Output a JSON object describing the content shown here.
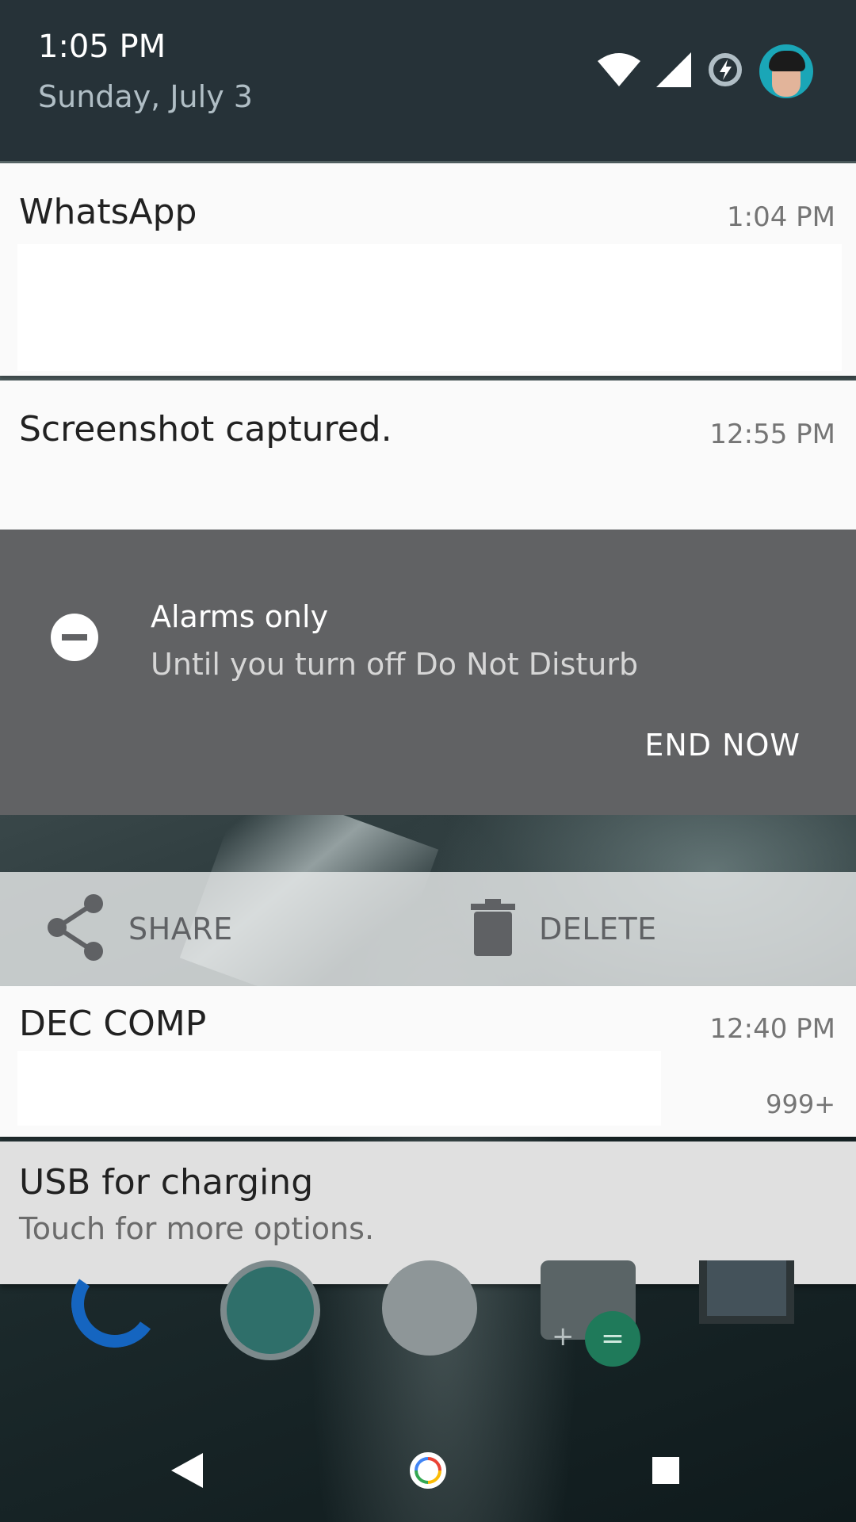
{
  "header": {
    "time": "1:05 PM",
    "date": "Sunday, July 3"
  },
  "status_icons": [
    "wifi-icon",
    "cell-signal-icon",
    "data-saver-icon",
    "avatar"
  ],
  "notifications": {
    "whatsapp": {
      "title": "WhatsApp",
      "time": "1:04 PM"
    },
    "screenshot": {
      "title": "Screenshot captured.",
      "time": "12:55 PM"
    },
    "dec_comp": {
      "title": "DEC COMP",
      "time": "12:40 PM",
      "count": "999+"
    },
    "usb": {
      "title": "USB for charging",
      "subtitle": "Touch for more options."
    }
  },
  "dnd": {
    "title": "Alarms only",
    "subtitle": "Until you turn off Do Not Disturb",
    "action": "END NOW"
  },
  "screenshot_actions": {
    "share": "SHARE",
    "delete": "DELETE"
  },
  "colors": {
    "header_bg": "#263238",
    "dnd_bg": "#616264",
    "card_bg": "#fafafa",
    "usb_bg": "#e0e0e0"
  },
  "navbar": [
    "back-icon",
    "home-icon",
    "recents-icon"
  ]
}
